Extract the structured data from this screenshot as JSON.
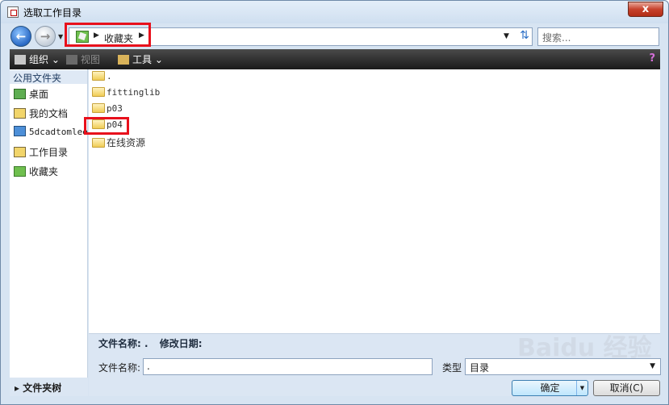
{
  "window": {
    "title": "选取工作目录",
    "close_label": "x"
  },
  "address_bar": {
    "current": "收藏夹"
  },
  "search": {
    "placeholder": "搜索..."
  },
  "toolbar": {
    "organize": "组织",
    "views": "视图",
    "tools": "工具"
  },
  "left_nav": {
    "header": "公用文件夹",
    "items": [
      {
        "label": "桌面",
        "icon": "desktop-icon"
      },
      {
        "label": "我的文档",
        "icon": "documents-icon"
      },
      {
        "label": "5dcadtomlee",
        "icon": "computer-icon"
      },
      {
        "label": "工作目录",
        "icon": "working-dir-icon"
      },
      {
        "label": "收藏夹",
        "icon": "favorites-icon"
      }
    ],
    "tree_toggle": "文件夹树"
  },
  "files": [
    {
      "name": "."
    },
    {
      "name": "fittinglib"
    },
    {
      "name": "p03"
    },
    {
      "name": "p04"
    },
    {
      "name": "在线资源"
    }
  ],
  "details": {
    "name_label": "文件名称: .",
    "modified_label": "修改日期:"
  },
  "bottom": {
    "filename_label": "文件名称:",
    "filename_value": ".",
    "type_label": "类型",
    "type_value": "目录",
    "ok_label": "确定",
    "cancel_label": "取消(C)"
  },
  "watermark": "Baidu 经验"
}
